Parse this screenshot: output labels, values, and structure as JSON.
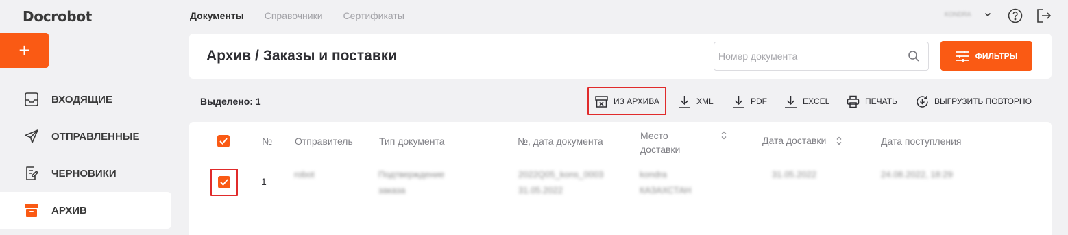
{
  "app": {
    "logo": "Docrobot",
    "add_label": "+"
  },
  "sidebar": {
    "items": [
      {
        "label": "ВХОДЯЩИЕ",
        "icon": "inbox-icon"
      },
      {
        "label": "ОТПРАВЛЕННЫЕ",
        "icon": "send-icon"
      },
      {
        "label": "ЧЕРНОВИКИ",
        "icon": "draft-icon"
      },
      {
        "label": "АРХИВ",
        "icon": "archive-icon",
        "active": true
      }
    ]
  },
  "topnav": {
    "tabs": [
      "Документы",
      "Справочники",
      "Сертификаты"
    ],
    "active": "Документы",
    "user": "KONDRA"
  },
  "header": {
    "title": "Архив / Заказы и поставки",
    "search_placeholder": "Номер документа",
    "filters_label": "ФИЛЬТРЫ"
  },
  "toolbar": {
    "selected": "Выделено: 1",
    "actions": {
      "unarchive": "ИЗ АРХИВА",
      "xml": "XML",
      "pdf": "PDF",
      "excel": "EXCEL",
      "print": "ПЕЧАТЬ",
      "reexport": "ВЫГРУЗИТЬ ПОВТОРНО"
    }
  },
  "table": {
    "columns": {
      "num": "№",
      "sender": "Отправитель",
      "doc_type": "Тип документа",
      "doc_num_date": "№, дата документа",
      "place_l1": "Место",
      "place_l2": "доставки",
      "delivery_date": "Дата доставки",
      "receipt_date": "Дата поступления"
    },
    "rows": [
      {
        "num": "1",
        "sender": "robot",
        "doc_type_l1": "Подтверждение",
        "doc_type_l2": "заказа",
        "doc_num_l1": "2022Q05_kons_0003",
        "doc_num_l2": "31.05.2022",
        "place_l1": "kondra",
        "place_l2": "КАЗАХСТАН",
        "delivery_date": "31.05.2022",
        "receipt_date": "24.08.2022, 18:29",
        "checked": true
      }
    ]
  },
  "colors": {
    "accent": "#fa5a14",
    "highlight": "#e02b2b"
  }
}
